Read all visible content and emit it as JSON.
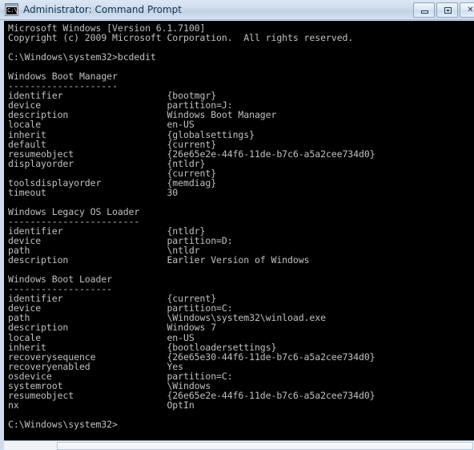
{
  "window": {
    "title": "Administrator: Command Prompt",
    "icon": "command-prompt-icon",
    "icon_text": "C:\\",
    "titlebar_color": "#cfdcec",
    "title_text_color": "#12314f"
  },
  "window_controls": {
    "minimize_label": "Minimize",
    "maximize_label": "Maximize",
    "close_label": "Close"
  },
  "console": {
    "background_color": "#000000",
    "text_color": "#c0c0c0",
    "banner": [
      "Microsoft Windows [Version 6.1.7100]",
      "Copyright (c) 2009 Microsoft Corporation.  All rights reserved."
    ],
    "prompt": "C:\\Windows\\system32>",
    "command": "bcdedit",
    "final_prompt": "C:\\Windows\\system32>",
    "sections": [
      {
        "heading": "Windows Boot Manager",
        "underline": "--------------------",
        "entries": [
          {
            "key": "identifier",
            "value": "{bootmgr}"
          },
          {
            "key": "device",
            "value": "partition=J:"
          },
          {
            "key": "description",
            "value": "Windows Boot Manager"
          },
          {
            "key": "locale",
            "value": "en-US"
          },
          {
            "key": "inherit",
            "value": "{globalsettings}"
          },
          {
            "key": "default",
            "value": "{current}"
          },
          {
            "key": "resumeobject",
            "value": "{26e65e2e-44f6-11de-b7c6-a5a2cee734d0}"
          },
          {
            "key": "displayorder",
            "value": "{ntldr}"
          },
          {
            "key": "",
            "value": "{current}"
          },
          {
            "key": "toolsdisplayorder",
            "value": "{memdiag}"
          },
          {
            "key": "timeout",
            "value": "30"
          }
        ]
      },
      {
        "heading": "Windows Legacy OS Loader",
        "underline": "------------------------",
        "entries": [
          {
            "key": "identifier",
            "value": "{ntldr}"
          },
          {
            "key": "device",
            "value": "partition=D:"
          },
          {
            "key": "path",
            "value": "\\ntldr"
          },
          {
            "key": "description",
            "value": "Earlier Version of Windows"
          }
        ]
      },
      {
        "heading": "Windows Boot Loader",
        "underline": "-------------------",
        "entries": [
          {
            "key": "identifier",
            "value": "{current}"
          },
          {
            "key": "device",
            "value": "partition=C:"
          },
          {
            "key": "path",
            "value": "\\Windows\\system32\\winload.exe"
          },
          {
            "key": "description",
            "value": "Windows 7"
          },
          {
            "key": "locale",
            "value": "en-US"
          },
          {
            "key": "inherit",
            "value": "{bootloadersettings}"
          },
          {
            "key": "recoverysequence",
            "value": "{26e65e30-44f6-11de-b7c6-a5a2cee734d0}"
          },
          {
            "key": "recoveryenabled",
            "value": "Yes"
          },
          {
            "key": "osdevice",
            "value": "partition=C:"
          },
          {
            "key": "systemroot",
            "value": "\\Windows"
          },
          {
            "key": "resumeobject",
            "value": "{26e65e2e-44f6-11de-b7c6-a5a2cee734d0}"
          },
          {
            "key": "nx",
            "value": "OptIn"
          }
        ]
      }
    ]
  },
  "scrollbar": {
    "orientation": "horizontal"
  }
}
